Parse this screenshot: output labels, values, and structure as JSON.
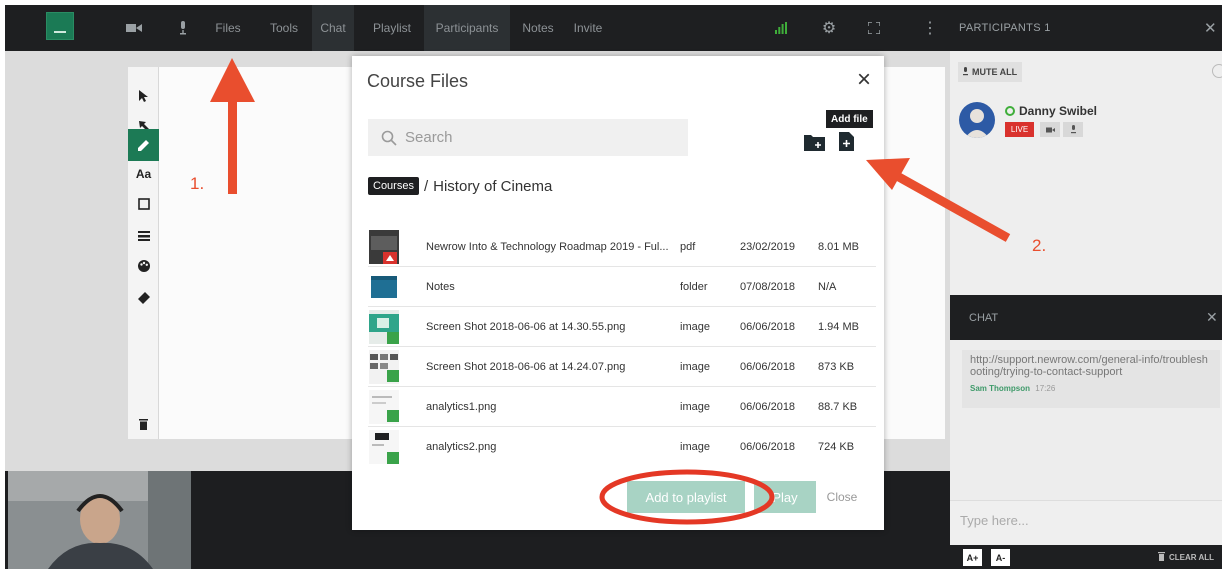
{
  "topbar": {
    "items": [
      "Files",
      "Tools",
      "Chat",
      "Playlist",
      "Participants",
      "Notes",
      "Invite"
    ]
  },
  "participants": {
    "header": "PARTICIPANTS 1",
    "mute_all": "MUTE ALL",
    "person": {
      "name": "Danny Swibel",
      "live_badge": "LIVE"
    }
  },
  "chat": {
    "header": "CHAT",
    "message": {
      "text": "http://support.newrow.com/general-info/troubleshooting/trying-to-contact-support",
      "author": "Sam Thompson",
      "time": "17:26"
    },
    "input_placeholder": "Type here...",
    "font_up": "A+",
    "font_down": "A-",
    "clear_all": "CLEAR ALL"
  },
  "toolbar": {
    "text_tool": "Aa"
  },
  "modal": {
    "title": "Course Files",
    "search_placeholder": "Search",
    "tooltip": "Add file",
    "breadcrumb": {
      "root": "Courses",
      "separator": "/",
      "current": "History of Cinema"
    },
    "files": [
      {
        "name": "Newrow Into & Technology Roadmap 2019 - Ful...",
        "type": "pdf",
        "date": "23/02/2019",
        "size": "8.01 MB"
      },
      {
        "name": "Notes",
        "type": "folder",
        "date": "07/08/2018",
        "size": "N/A"
      },
      {
        "name": "Screen Shot 2018-06-06 at 14.30.55.png",
        "type": "image",
        "date": "06/06/2018",
        "size": "1.94 MB"
      },
      {
        "name": "Screen Shot 2018-06-06 at 14.24.07.png",
        "type": "image",
        "date": "06/06/2018",
        "size": "873 KB"
      },
      {
        "name": "analytics1.png",
        "type": "image",
        "date": "06/06/2018",
        "size": "88.7 KB"
      },
      {
        "name": "analytics2.png",
        "type": "image",
        "date": "06/06/2018",
        "size": "724 KB"
      }
    ],
    "add_to_playlist": "Add to playlist",
    "play": "Play",
    "close": "Close"
  },
  "annotations": {
    "step1": "1.",
    "step2": "2."
  },
  "colors": {
    "accent": "#1c7a55",
    "annotation": "#e94e2e",
    "live": "#d9322d",
    "button_disabled": "#a8d3c4"
  }
}
